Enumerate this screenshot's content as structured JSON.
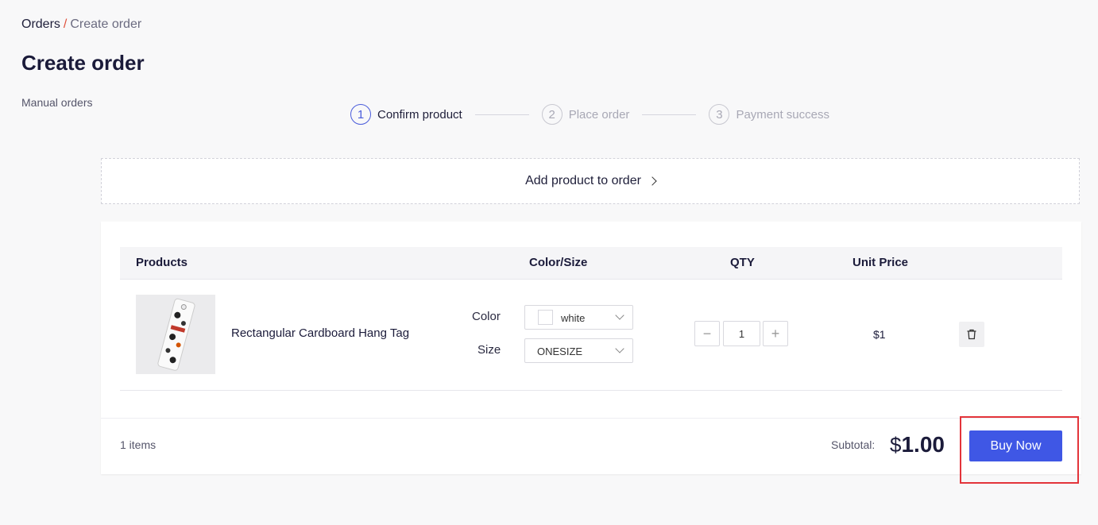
{
  "breadcrumb": {
    "root": "Orders",
    "separator": "/",
    "current": "Create order"
  },
  "page_title": "Create order",
  "side_label": "Manual orders",
  "steps": [
    {
      "num": "1",
      "label": "Confirm product",
      "active": true
    },
    {
      "num": "2",
      "label": "Place order",
      "active": false
    },
    {
      "num": "3",
      "label": "Payment success",
      "active": false
    }
  ],
  "add_product_label": "Add product to order",
  "table": {
    "headers": {
      "products": "Products",
      "color_size": "Color/Size",
      "qty": "QTY",
      "unit_price": "Unit Price"
    },
    "row": {
      "product_name": "Rectangular Cardboard Hang Tag",
      "color_label": "Color",
      "color_value": "white",
      "size_label": "Size",
      "size_value": "ONESIZE",
      "qty_minus": "−",
      "qty": "1",
      "qty_plus": "+",
      "unit_price": "$1"
    }
  },
  "footer": {
    "items_count": "1 items",
    "subtotal_label": "Subtotal:",
    "currency": "$",
    "subtotal_value": "1.00",
    "buy_label": "Buy Now"
  },
  "colors": {
    "accent": "#3f57e5",
    "highlight": "#e3343a"
  },
  "icons": {
    "trash": "trash-icon",
    "chevron": "chevron-right-icon",
    "caret": "chevron-down-icon"
  }
}
